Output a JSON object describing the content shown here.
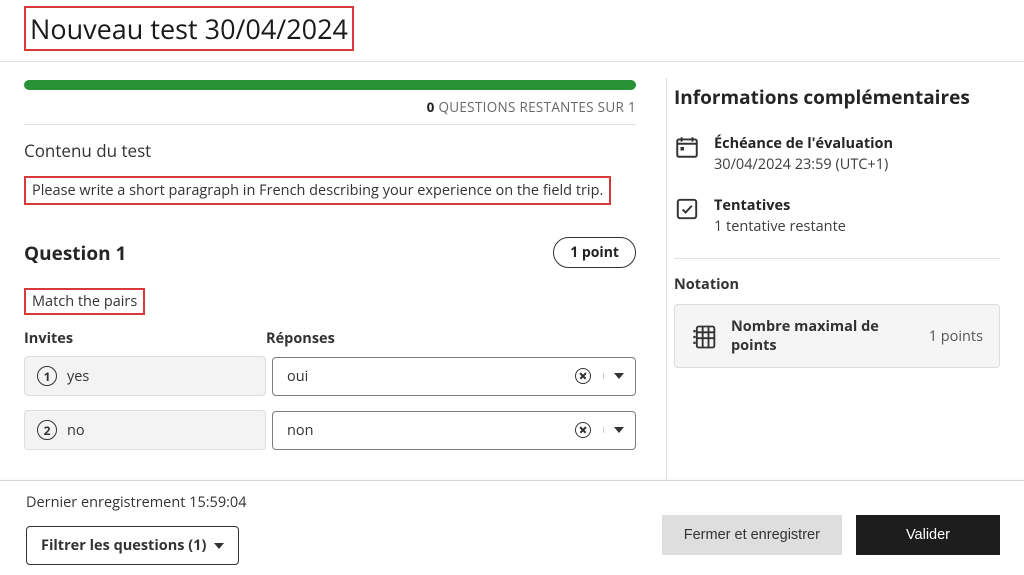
{
  "title": "Nouveau test 30/04/2024",
  "progress": {
    "count": "0",
    "label": "QUESTIONS RESTANTES SUR 1"
  },
  "content": {
    "heading": "Contenu du test",
    "description": "Please write a short paragraph in French describing your experience on the field trip."
  },
  "question": {
    "title": "Question 1",
    "points": "1 point",
    "instruction": "Match the pairs",
    "col_invites": "Invites",
    "col_reponses": "Réponses",
    "rows": [
      {
        "num": "1",
        "invite": "yes",
        "reponse": "oui"
      },
      {
        "num": "2",
        "invite": "no",
        "reponse": "non"
      }
    ]
  },
  "sidebar": {
    "title": "Informations complémentaires",
    "due": {
      "label": "Échéance de l'évaluation",
      "value": "30/04/2024 23:59 (UTC+1)"
    },
    "attempts": {
      "label": "Tentatives",
      "value": "1 tentative restante"
    },
    "notation_heading": "Notation",
    "notation": {
      "label": "Nombre maximal de points",
      "value": "1 points"
    }
  },
  "footer": {
    "last_saved": "Dernier enregistrement 15:59:04",
    "filter": "Filtrer les questions (1)",
    "close_save": "Fermer et enregistrer",
    "submit": "Valider"
  }
}
